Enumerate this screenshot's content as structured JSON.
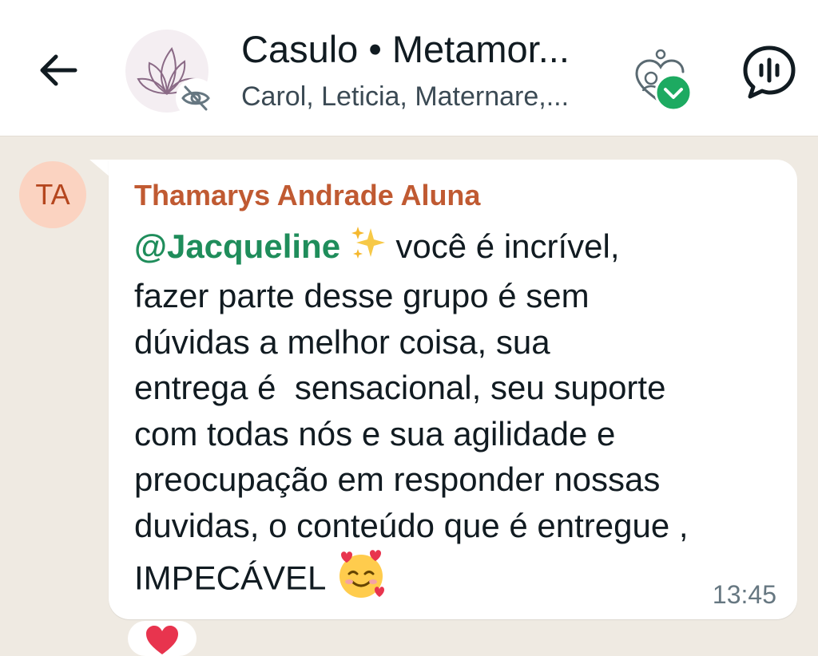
{
  "header": {
    "title": "Casulo • Metamor...",
    "subtitle": "Carol, Leticia, Maternare,..."
  },
  "message": {
    "avatar_initials": "TA",
    "sender": "Thamarys Andrade Aluna",
    "mention": "@Jacqueline",
    "line1_after": " você é incrível,",
    "body": "fazer parte desse grupo é sem\ndúvidas a melhor coisa, sua\nentrega é  sensacional, seu suporte\ncom todas nós e sua agilidade e\npreocupação em responder nossas\nduvidas, o conteúdo que é entregue ,\nIMPECÁVEL",
    "time": "13:45"
  },
  "colors": {
    "chat_bg": "#efeae2",
    "sender": "#c05a32",
    "mention": "#1f8d5b",
    "badge": "#1daa61"
  },
  "icons": {
    "back": "arrow-left-icon",
    "hidden": "eye-off-icon",
    "community": "community-heart-icon",
    "voice": "voice-chat-icon",
    "sparkles": "sparkles-emoji",
    "smiling_hearts": "smiling-face-with-hearts-emoji",
    "reaction": "red-heart-emoji"
  }
}
